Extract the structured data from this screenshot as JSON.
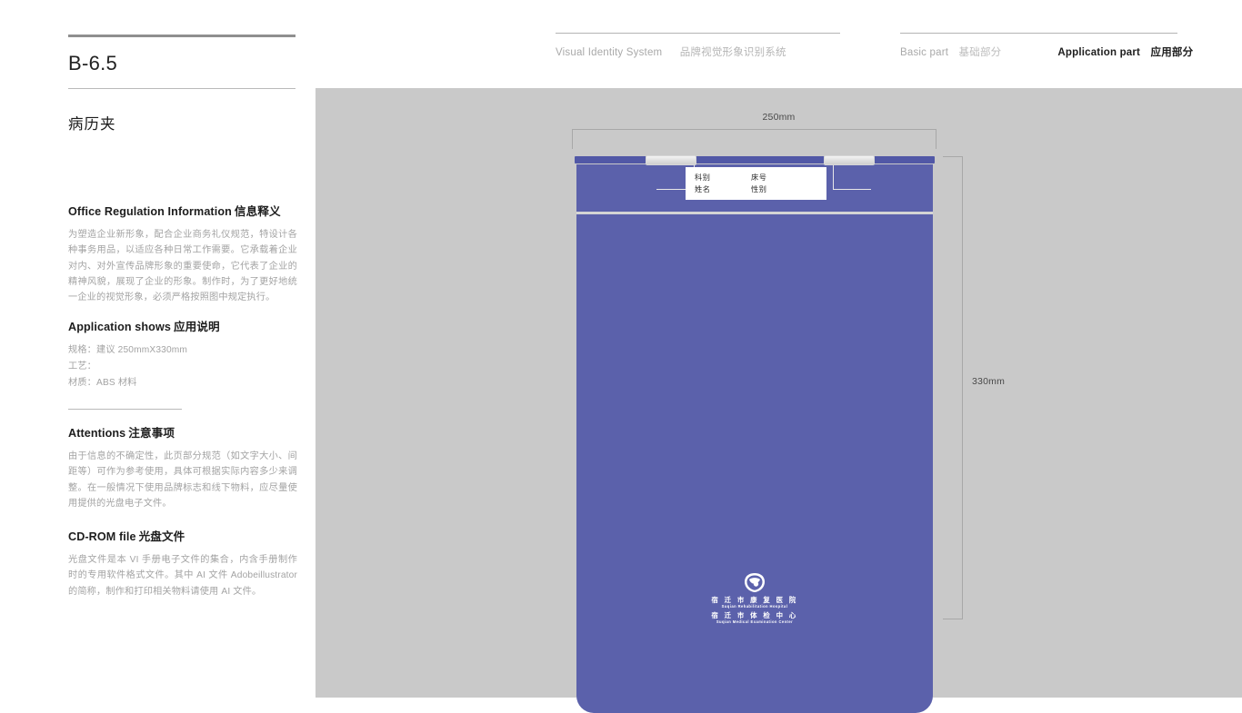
{
  "header": {
    "vis_en": "Visual Identity System",
    "vis_cn": "品牌视觉形象识别系统",
    "basic_en": "Basic part",
    "basic_cn": "基础部分",
    "application_en": "Application part",
    "application_cn": "应用部分"
  },
  "left": {
    "code": "B-6.5",
    "title": "病历夹",
    "sections": {
      "office": {
        "heading_en": "Office Regulation Information",
        "heading_cn": "信息释义",
        "body": "为塑造企业新形象，配合企业商务礼仪规范，特设计各种事务用品，以适应各种日常工作需要。它承载着企业对内、对外宣传品牌形象的重要使命，它代表了企业的精神风貌，展现了企业的形象。制作时，为了更好地统一企业的视觉形象，必须严格按照图中规定执行。"
      },
      "application": {
        "heading_en": "Application shows",
        "heading_cn": "应用说明",
        "spec_size": "规格：建议 250mmX330mm",
        "spec_craft": "工艺：",
        "spec_material": "材质：ABS 材料"
      },
      "attentions": {
        "heading_en": "Attentions",
        "heading_cn": "注意事项",
        "body": "由于信息的不确定性，此页部分规范（如文字大小、间距等）可作为参考使用，具体可根据实际内容多少来调整。在一般情况下使用品牌标志和线下物料，应尽量使用提供的光盘电子文件。"
      },
      "cdrom": {
        "heading_en": "CD-ROM file",
        "heading_cn": "光盘文件",
        "body": "光盘文件是本 VI 手册电子文件的集合，内含手册制作时的专用软件格式文件。其中 AI 文件 Adobeillustrator 的简称，制作和打印相关物料请使用 AI 文件。"
      }
    }
  },
  "stage": {
    "dim_width": "250mm",
    "dim_height": "330mm",
    "product": {
      "info_card": {
        "row1_left": "科别",
        "row1_right": "床号",
        "row2_left": "姓名",
        "row2_right": "性别"
      },
      "logo": {
        "cn_line1": "宿 迁 市 康 复 医 院",
        "en_line1": "Suqian Rehabilitation Hospital",
        "cn_line2": "宿 迁 市 体 检 中 心",
        "en_line2": "Suqian Medical Examination Center"
      }
    }
  },
  "colors": {
    "brand_purple": "#5b61ab",
    "spine_purple": "#5158a6",
    "stage_gray": "#c9c9c9",
    "page_white": "#ffffff",
    "muted_text": "#a3a3a3"
  }
}
